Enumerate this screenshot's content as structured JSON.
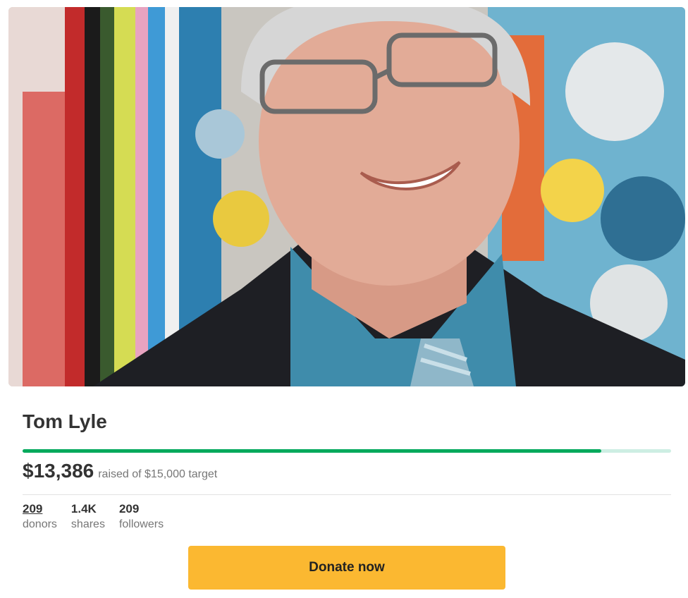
{
  "campaign": {
    "title": "Tom Lyle",
    "amount_raised": "$13,386",
    "target_text": "raised of $15,000 target",
    "progress_fraction": 0.8924
  },
  "stats": [
    {
      "value": "209",
      "label": "donors"
    },
    {
      "value": "1.4K",
      "label": "shares"
    },
    {
      "value": "209",
      "label": "followers"
    }
  ],
  "actions": {
    "donate_label": "Donate now"
  },
  "colors": {
    "progress": "#02a95c",
    "progress_track": "#cdeee3",
    "donate_button": "#fbb831"
  }
}
